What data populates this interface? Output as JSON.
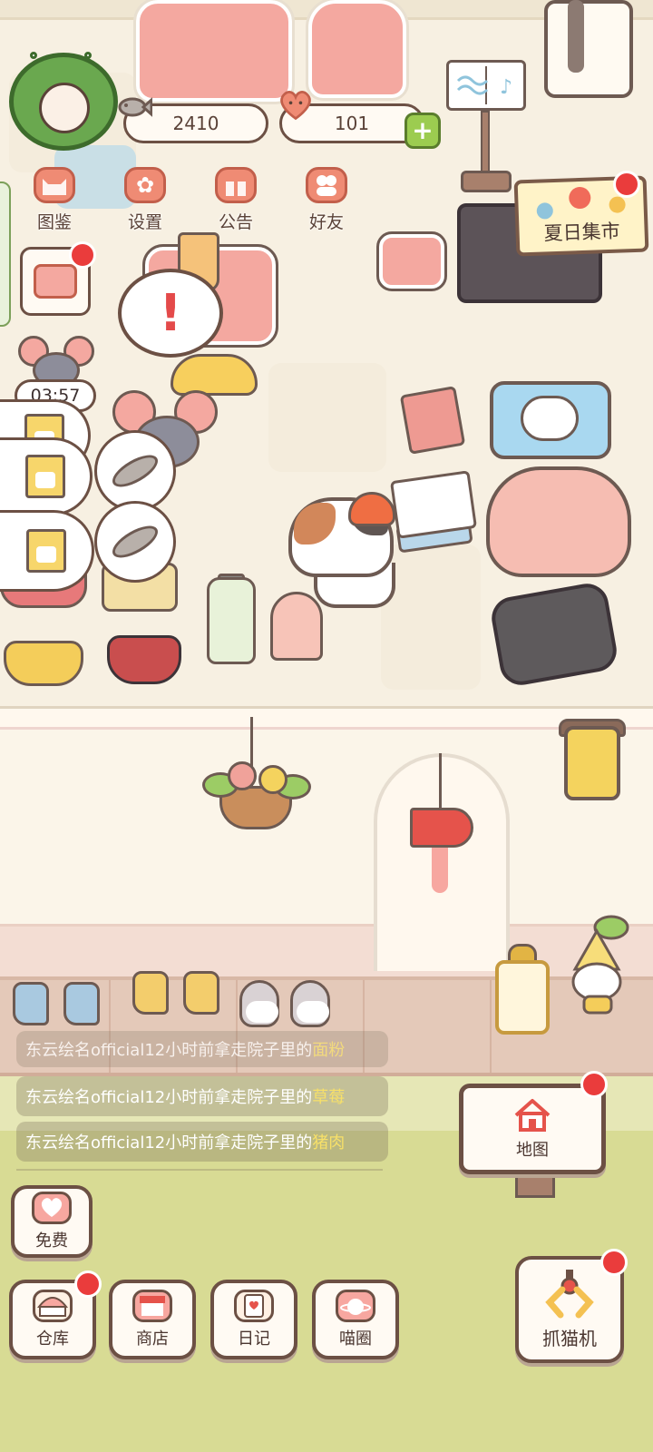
{
  "hud": {
    "fish_count": "2410",
    "heart_count": "101",
    "plus": "+"
  },
  "menu": [
    {
      "label": "图鉴"
    },
    {
      "label": "设置"
    },
    {
      "label": "公告"
    },
    {
      "label": "好友"
    }
  ],
  "event_sign": {
    "label": "夏日集市"
  },
  "timer": "03:57",
  "alert": "!",
  "feed": [
    {
      "prefix": "东云绘名official12小时前拿走院子里的",
      "item": "面粉"
    },
    {
      "prefix": "东云绘名official12小时前拿走院子里的",
      "item": "草莓"
    },
    {
      "prefix": "东云绘名official12小时前拿走院子里的",
      "item": "猪肉"
    }
  ],
  "buttons": {
    "free": "免费",
    "warehouse": "仓库",
    "shop": "商店",
    "diary": "日记",
    "meow_circle": "喵圈",
    "map": "地图",
    "claw_machine": "抓猫机"
  },
  "colors": {
    "accent_red": "#ea3c3c",
    "highlight_yellow": "#f7e069",
    "frame_brown": "#6c5044",
    "lawn_green": "#d8db94"
  },
  "icons": {
    "fish": "fish-icon",
    "heart": "heart-icon",
    "catalog": "cat-head-icon",
    "settings": "gear-icon",
    "notice": "gift-icon",
    "friends": "friends-icon",
    "map": "house-icon",
    "claw": "claw-icon"
  }
}
